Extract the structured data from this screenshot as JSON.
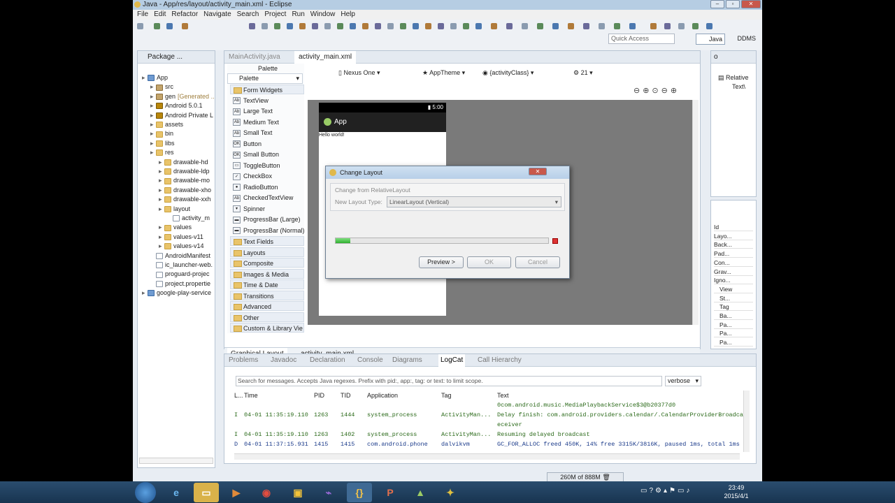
{
  "window": {
    "title": "Java - App/res/layout/activity_main.xml - Eclipse"
  },
  "menu": [
    "File",
    "Edit",
    "Refactor",
    "Navigate",
    "Search",
    "Project",
    "Run",
    "Window",
    "Help"
  ],
  "quick_access": {
    "placeholder": "Quick Access"
  },
  "perspectives": {
    "java": "Java",
    "ddms": "DDMS"
  },
  "package_explorer": {
    "title": "Package ...",
    "items": [
      {
        "label": "App",
        "type": "prj"
      },
      {
        "label": "src",
        "type": "pkg"
      },
      {
        "label": "gen",
        "suffix": "[Generated ...",
        "type": "pkg"
      },
      {
        "label": "Android 5.0.1",
        "type": "jar"
      },
      {
        "label": "Android Private L",
        "type": "jar"
      },
      {
        "label": "assets",
        "type": "folder"
      },
      {
        "label": "bin",
        "type": "folder"
      },
      {
        "label": "libs",
        "type": "folder"
      },
      {
        "label": "res",
        "type": "folder"
      },
      {
        "label": "drawable-hd",
        "type": "folder"
      },
      {
        "label": "drawable-ldp",
        "type": "folder"
      },
      {
        "label": "drawable-mo",
        "type": "folder"
      },
      {
        "label": "drawable-xho",
        "type": "folder"
      },
      {
        "label": "drawable-xxh",
        "type": "folder"
      },
      {
        "label": "layout",
        "type": "folder"
      },
      {
        "label": "activity_m",
        "type": "file"
      },
      {
        "label": "values",
        "type": "folder"
      },
      {
        "label": "values-v11",
        "type": "folder"
      },
      {
        "label": "values-v14",
        "type": "folder"
      },
      {
        "label": "AndroidManifest",
        "type": "file"
      },
      {
        "label": "ic_launcher-web.",
        "type": "file"
      },
      {
        "label": "proguard-projec",
        "type": "file"
      },
      {
        "label": "project.propertie",
        "type": "file"
      },
      {
        "label": "google-play-service",
        "type": "prj"
      }
    ]
  },
  "editor": {
    "tabs": [
      "MainActivity.java",
      "activity_main.xml"
    ],
    "toolbar": {
      "device": "Nexus One",
      "theme": "AppTheme",
      "activity": "{activityClass}",
      "api": "21"
    },
    "bottom_tabs": [
      "Graphical Layout",
      "activity_main.xml"
    ]
  },
  "palette": {
    "header": "Palette",
    "title": "Palette",
    "items": [
      {
        "label": "Form Widgets",
        "cat": true
      },
      {
        "label": "TextView",
        "icon": "Ab"
      },
      {
        "label": "Large Text",
        "icon": "Ab"
      },
      {
        "label": "Medium Text",
        "icon": "Ab"
      },
      {
        "label": "Small Text",
        "icon": "Ab"
      },
      {
        "label": "Button",
        "icon": "OK"
      },
      {
        "label": "Small Button",
        "icon": "OK"
      },
      {
        "label": "ToggleButton",
        "icon": "▭"
      },
      {
        "label": "CheckBox",
        "icon": "✓"
      },
      {
        "label": "RadioButton",
        "icon": "●"
      },
      {
        "label": "CheckedTextView",
        "icon": "Ab"
      },
      {
        "label": "Spinner",
        "icon": "▾"
      },
      {
        "label": "ProgressBar (Large)",
        "icon": "▬"
      },
      {
        "label": "ProgressBar (Normal)",
        "icon": "▬"
      },
      {
        "label": "Text Fields",
        "cat": true
      },
      {
        "label": "Layouts",
        "cat": true
      },
      {
        "label": "Composite",
        "cat": true
      },
      {
        "label": "Images & Media",
        "cat": true
      },
      {
        "label": "Time & Date",
        "cat": true
      },
      {
        "label": "Transitions",
        "cat": true
      },
      {
        "label": "Advanced",
        "cat": true
      },
      {
        "label": "Other",
        "cat": true
      },
      {
        "label": "Custom & Library Vie",
        "cat": true
      }
    ]
  },
  "device": {
    "time": "5:00",
    "app_title": "App",
    "hello": "Hello world!"
  },
  "dialog": {
    "title": "Change Layout",
    "from_label": "Change from RelativeLayout",
    "type_label": "New Layout Type:",
    "type_value": "LinearLayout (Vertical)",
    "progress": 0.07,
    "preview": "Preview >",
    "ok": "OK",
    "cancel": "Cancel"
  },
  "outline": {
    "item1": "Relative",
    "item2": "Text\\"
  },
  "properties": {
    "rows": [
      "Id",
      "Layo...",
      "Back...",
      "Pad...",
      "Con...",
      "Grav...",
      "Igno...",
      "View",
      "St...",
      "Tag",
      "Ba...",
      "Pa...",
      "Pa...",
      "Pa..."
    ]
  },
  "bottom_panel": {
    "tabs": [
      "Problems",
      "Javadoc",
      "Declaration",
      "Console",
      "Diagrams",
      "LogCat",
      "Call Hierarchy"
    ],
    "search_placeholder": "Search for messages. Accepts Java regexes. Prefix with pid:, app:, tag: or text: to limit scope.",
    "level": "verbose",
    "columns": [
      "L...",
      "Time",
      "PID",
      "TID",
      "Application",
      "Tag",
      "Text"
    ],
    "rows": [
      {
        "l": "",
        "time": "",
        "pid": "",
        "tid": "",
        "app": "",
        "tag": "",
        "text": "0com.android.music.MediaPlaybackService$3@b20377d0"
      },
      {
        "l": "I",
        "time": "04-01 11:35:19.110",
        "pid": "1263",
        "tid": "1444",
        "app": "system_process",
        "tag": "ActivityMan...",
        "text": "Delay finish: com.android.providers.calendar/.CalendarProviderBroadca"
      },
      {
        "l": "",
        "time": "",
        "pid": "",
        "tid": "",
        "app": "",
        "tag": "",
        "text": "eceiver"
      },
      {
        "l": "I",
        "time": "04-01 11:35:19.110",
        "pid": "1263",
        "tid": "1402",
        "app": "system_process",
        "tag": "ActivityMan...",
        "text": "Resuming delayed broadcast"
      },
      {
        "l": "D",
        "time": "04-01 11:37:15.931",
        "pid": "1415",
        "tid": "1415",
        "app": "com.android.phone",
        "tag": "dalvikvm",
        "text": "GC_FOR_ALLOC freed 450K, 14% free 3315K/3816K, paused 1ms, total 1ms"
      }
    ]
  },
  "status": {
    "heap": "260M of 888M"
  },
  "taskbar": {
    "time": "23:49",
    "date": "2015/4/1"
  }
}
